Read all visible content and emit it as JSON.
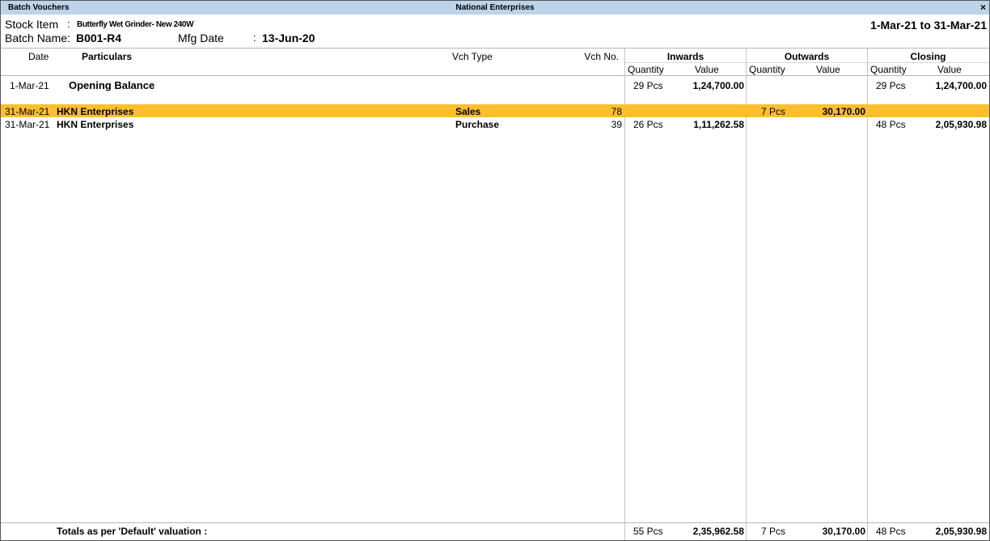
{
  "titlebar": {
    "left": "Batch Vouchers",
    "center": "National Enterprises",
    "close": "×"
  },
  "header": {
    "stock_item_label": "Stock Item",
    "stock_item_sep": ":",
    "stock_item_value": "Butterfly Wet Grinder- New 240W",
    "batch_name_label": "Batch Name:",
    "batch_name_value": "B001-R4",
    "mfg_date_label": "Mfg Date",
    "mfg_date_sep": ":",
    "mfg_date_value": "13-Jun-20",
    "period": "1-Mar-21 to 31-Mar-21"
  },
  "columns": {
    "date": "Date",
    "particulars": "Particulars",
    "vch_type": "Vch Type",
    "vch_no": "Vch No.",
    "inwards": "Inwards",
    "outwards": "Outwards",
    "closing": "Closing",
    "quantity": "Quantity",
    "value": "Value"
  },
  "opening": {
    "date": "1-Mar-21",
    "particulars": "Opening Balance",
    "in_qty": "29 Pcs",
    "in_val": "1,24,700.00",
    "cl_qty": "29 Pcs",
    "cl_val": "1,24,700.00"
  },
  "rows": [
    {
      "date": "31-Mar-21",
      "particulars": "HKN Enterprises",
      "vch_type": "Sales",
      "vch_no": "78",
      "in_qty": "",
      "in_val": "",
      "out_qty": "7 Pcs",
      "out_val": "30,170.00",
      "cl_qty": "",
      "cl_val": ""
    },
    {
      "date": "31-Mar-21",
      "particulars": "HKN Enterprises",
      "vch_type": "Purchase",
      "vch_no": "39",
      "in_qty": "26 Pcs",
      "in_val": "1,11,262.58",
      "out_qty": "",
      "out_val": "",
      "cl_qty": "48 Pcs",
      "cl_val": "2,05,930.98"
    }
  ],
  "totals": {
    "label": "Totals as per 'Default' valuation :",
    "in_qty": "55 Pcs",
    "in_val": "2,35,962.58",
    "out_qty": "7 Pcs",
    "out_val": "30,170.00",
    "cl_qty": "48 Pcs",
    "cl_val": "2,05,930.98"
  },
  "colors": {
    "titlebar": "#bcd4ea",
    "highlight": "#fbbf2e"
  }
}
